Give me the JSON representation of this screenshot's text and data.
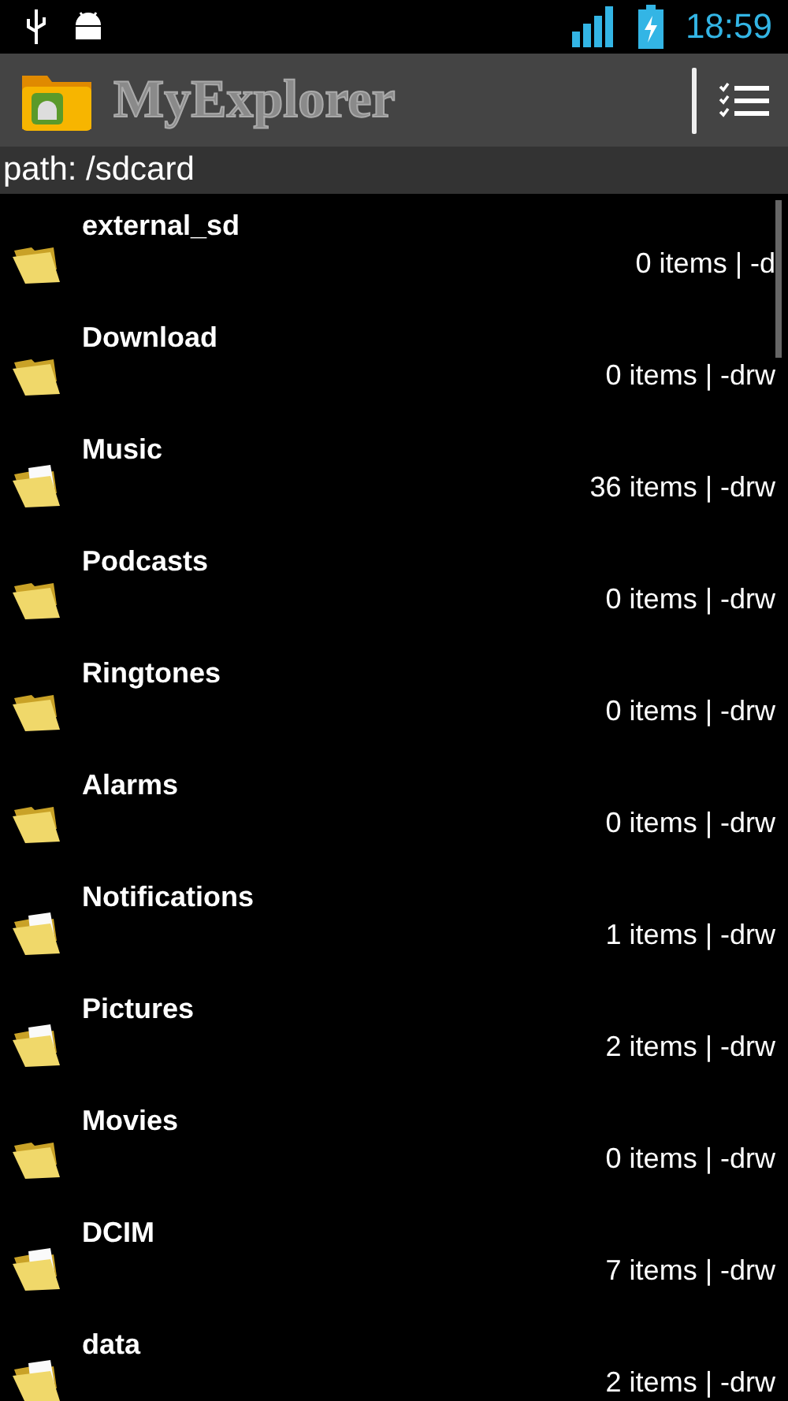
{
  "status_bar": {
    "time": "18:59"
  },
  "app_bar": {
    "title": "MyExplorer"
  },
  "path": "path: /sdcard",
  "files": [
    {
      "name": "external_sd",
      "details": "0 items | -d",
      "has_files": false
    },
    {
      "name": "Download",
      "details": "0 items | -drw",
      "has_files": false
    },
    {
      "name": "Music",
      "details": "36 items | -drw",
      "has_files": true
    },
    {
      "name": "Podcasts",
      "details": "0 items | -drw",
      "has_files": false
    },
    {
      "name": "Ringtones",
      "details": "0 items | -drw",
      "has_files": false
    },
    {
      "name": "Alarms",
      "details": "0 items | -drw",
      "has_files": false
    },
    {
      "name": "Notifications",
      "details": "1 items | -drw",
      "has_files": true
    },
    {
      "name": "Pictures",
      "details": "2 items | -drw",
      "has_files": true
    },
    {
      "name": "Movies",
      "details": "0 items | -drw",
      "has_files": false
    },
    {
      "name": "DCIM",
      "details": "7 items | -drw",
      "has_files": true
    },
    {
      "name": "data",
      "details": "2 items | -drw",
      "has_files": true
    }
  ]
}
